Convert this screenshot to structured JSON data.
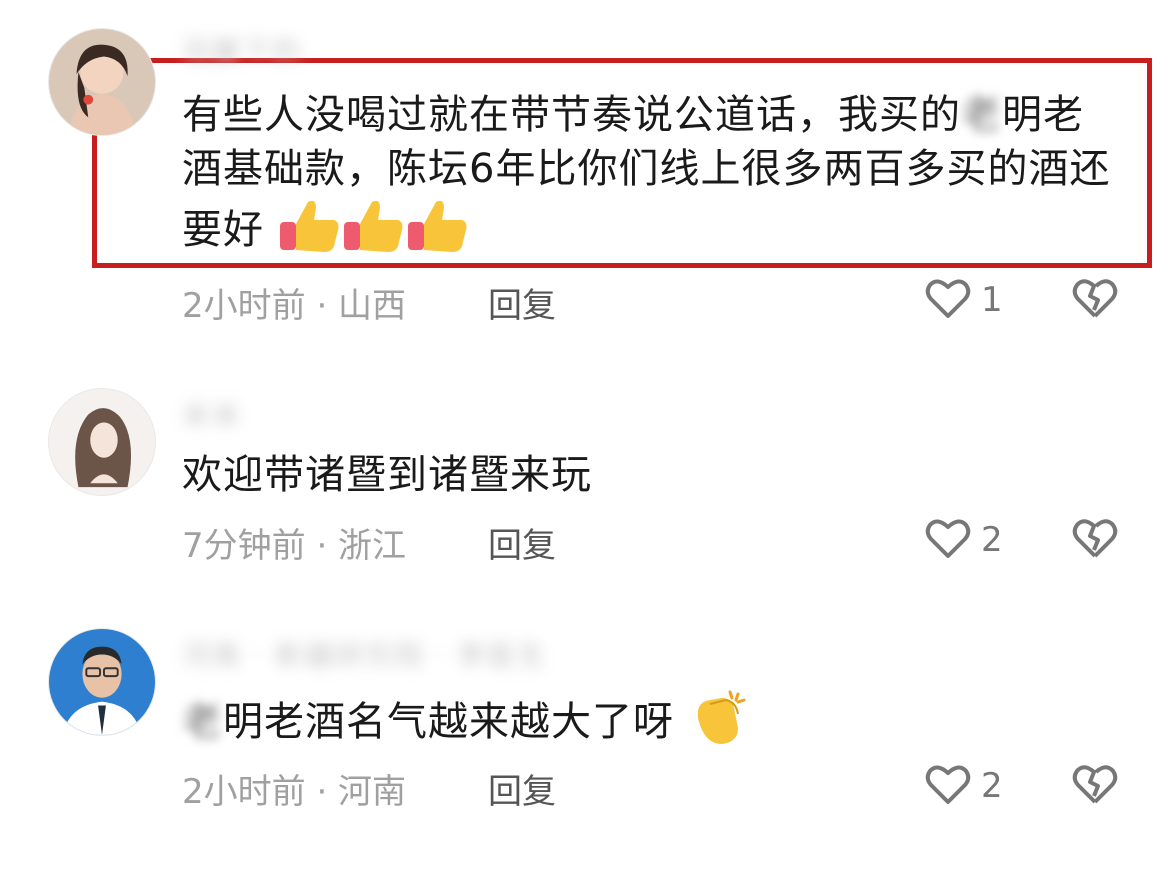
{
  "comments": [
    {
      "username": "羽翼下的",
      "text_parts": [
        "有些人没喝过就在带节奏说公道话，我买的",
        "明老酒基础款，陈坛6年比你们线上很多两百多买的酒还要好"
      ],
      "blurred_char": "老",
      "time_location": "2小时前 · 山西",
      "reply_label": "回复",
      "likes": "1",
      "emoji": "thumbs-up x3"
    },
    {
      "username": "米米",
      "text": "欢迎带诸暨到诸暨来玩",
      "time_location": "7分钟前 · 浙江",
      "reply_label": "回复",
      "likes": "2"
    },
    {
      "username": "河南 · 新疆研究院 · 李医生",
      "text_parts": [
        "",
        "明老酒名气越来越大了呀"
      ],
      "blurred_char": "老",
      "time_location": "2小时前 · 河南",
      "reply_label": "回复",
      "likes": "2",
      "emoji": "clapping-hands"
    }
  ],
  "icons": {
    "like": "heart-outline-icon",
    "dislike": "broken-heart-icon"
  },
  "colors": {
    "highlight_border": "#c81e1e",
    "meta_text": "#a0a0a0"
  }
}
